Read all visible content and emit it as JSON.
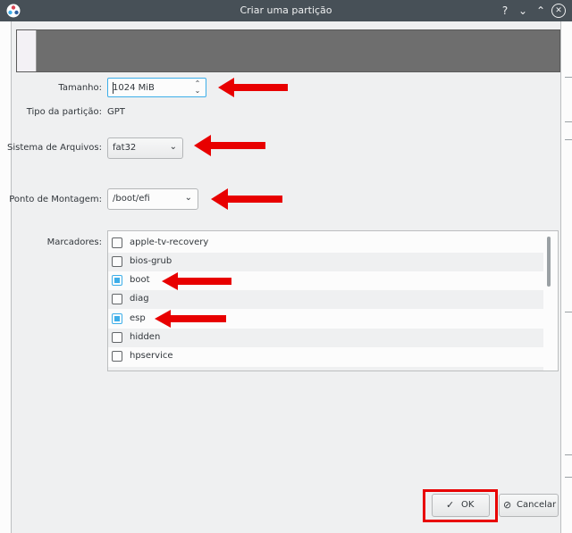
{
  "window": {
    "title": "Criar uma partição",
    "help_glyph": "?",
    "min_glyph": "⌄",
    "max_glyph": "⌃",
    "close_glyph": "✕"
  },
  "form": {
    "size_label": "Tamanho:",
    "size_value": "1024 MiB",
    "type_label": "Tipo da partição:",
    "type_value": "GPT",
    "fs_label": "Sistema de Arquivos:",
    "fs_value": "fat32",
    "mount_label": "Ponto de Montagem:",
    "mount_value": "/boot/efi",
    "flags_label": "Marcadores:"
  },
  "flags": [
    {
      "label": "apple-tv-recovery",
      "checked": false
    },
    {
      "label": "bios-grub",
      "checked": false
    },
    {
      "label": "boot",
      "checked": true
    },
    {
      "label": "diag",
      "checked": false
    },
    {
      "label": "esp",
      "checked": true
    },
    {
      "label": "hidden",
      "checked": false
    },
    {
      "label": "hpservice",
      "checked": false
    }
  ],
  "buttons": {
    "ok_label": "OK",
    "cancel_label": "Cancelar"
  },
  "colors": {
    "accent": "#3daee9",
    "annotation_red": "#e80000",
    "titlebar": "#475057"
  }
}
